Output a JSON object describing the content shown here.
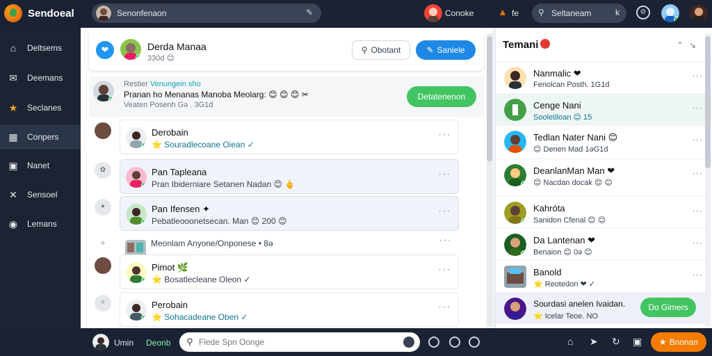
{
  "topbar": {
    "brand": "Sendoeal",
    "search_text": "Senonfenaon",
    "user_name": "Conoke",
    "flame_label": "fe",
    "search2_text": "Seltaneam",
    "search2_key": "k"
  },
  "sidebar": {
    "items": [
      {
        "label": "Deltsems",
        "icon": "home-icon"
      },
      {
        "label": "Deemans",
        "icon": "chat-icon"
      },
      {
        "label": "Seclanes",
        "icon": "badge-icon"
      },
      {
        "label": "Conpers",
        "icon": "book-icon"
      },
      {
        "label": "Nanet",
        "icon": "card-icon"
      },
      {
        "label": "Sensoel",
        "icon": "close-icon"
      },
      {
        "label": "Lemans",
        "icon": "globe-icon"
      }
    ]
  },
  "header": {
    "name": "Derda Manaa",
    "sub": "330d 😊",
    "outline_button": "Obotant",
    "primary_button": "Saniele"
  },
  "note": {
    "label_prefix": "Restier",
    "label_highlight": "Venungein sho",
    "text": "Pranan ho Menanas Manoba Meolarg: 😊 😊 😊 ✂",
    "meta": "Veaten Posenh Gə . 3G1d",
    "button": "Detatenenon"
  },
  "list": [
    {
      "name": "Derobain",
      "sub": "⭐ Souradlecoane Oiean ✓",
      "style": "",
      "teal": true
    },
    {
      "name": "Pan Tapleana",
      "sub": "Pran Ibiderniare Setanen Nadan 😊 🖕",
      "style": "hl",
      "teal": false
    },
    {
      "name": "Pan Ifensen ✦",
      "sub": "Pebatleooonetsecan. Man 😊 200 😊",
      "style": "hl",
      "teal": false
    },
    {
      "name": "",
      "sub": "Meonlam Anyone/Onponese • 8ə",
      "style": "flat",
      "teal": false
    },
    {
      "name": "Pimot 🌿",
      "sub": "⭐ Bosatlecleane Oleon ✓",
      "style": "",
      "teal": false
    },
    {
      "name": "Perobain",
      "sub": "⭐ Sohacadeane Oben ✓",
      "style": "",
      "teal": true
    }
  ],
  "right": {
    "title": "Temani",
    "contacts": [
      {
        "name": "Nanmalic ❤",
        "status": "Fenolcan Posth. 1G1d",
        "style": "",
        "teal": false
      },
      {
        "name": "Cenge Nani",
        "status": "Sooletiloan 😊 15",
        "style": "active",
        "teal": true
      },
      {
        "name": "Tedlan Nater Nani 😊",
        "status": "😊 Denen Mad 1əG1d",
        "style": "",
        "teal": false
      },
      {
        "name": "DeanlanMan Man ❤",
        "status": "😊 Nacdan docak 😊 😊",
        "style": "",
        "teal": false
      },
      {
        "name": "Kahróta",
        "status": "Sanidon Cfenal 😊 😊",
        "style": "",
        "teal": false
      },
      {
        "name": "Da Lantenan ❤",
        "status": "Benaion 😊 0ə 😊",
        "style": "",
        "teal": false
      },
      {
        "name": "Banold",
        "status": "⭐ Reotedon ❤ ✓",
        "style": "",
        "teal": false
      },
      {
        "name": "Sourdasi anelen Ivaidan.",
        "status": "⭐ Icelar Teoe. NO",
        "style": "last",
        "teal": false
      }
    ],
    "pill": "Do Gimers"
  },
  "bottombar": {
    "user": "Umin",
    "status": "Deonb",
    "composer_placeholder": "Flede Spn Oonge",
    "cta": "Bnonan"
  },
  "colors": {
    "accent": "#1e88e5",
    "green": "#43c463",
    "dark": "#1a2233",
    "orange": "#f57c00"
  }
}
